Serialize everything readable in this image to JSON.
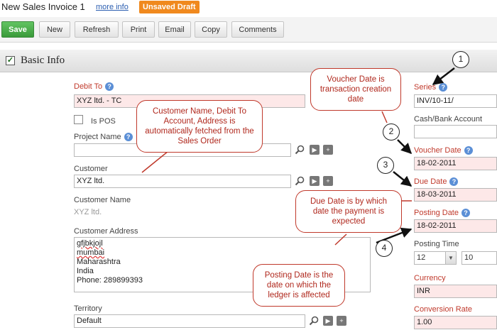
{
  "header": {
    "title": "New Sales Invoice 1",
    "more_info": "more info",
    "status": "Unsaved Draft"
  },
  "toolbar": {
    "save": "Save",
    "new": "New",
    "refresh": "Refresh",
    "print": "Print",
    "email": "Email",
    "copy": "Copy",
    "comments": "Comments"
  },
  "section": {
    "title": "Basic Info",
    "checked": "✓"
  },
  "left": {
    "debit_to": {
      "label": "Debit To",
      "value": "XYZ ltd. - TC"
    },
    "is_pos": {
      "label": "Is POS"
    },
    "project_name": {
      "label": "Project Name",
      "value": ""
    },
    "customer": {
      "label": "Customer",
      "value": "XYZ ltd."
    },
    "customer_name": {
      "label": "Customer Name",
      "value": "XYZ ltd."
    },
    "customer_address": {
      "label": "Customer Address",
      "lines": [
        "gfjbkjojl",
        "mumbai",
        "Maharashtra",
        "India",
        "Phone: 289899393"
      ]
    },
    "territory": {
      "label": "Territory",
      "value": "Default"
    }
  },
  "right": {
    "series": {
      "label": "Series",
      "value": "INV/10-11/"
    },
    "cash_bank": {
      "label": "Cash/Bank Account",
      "value": ""
    },
    "voucher_date": {
      "label": "Voucher Date",
      "value": "18-02-2011"
    },
    "due_date": {
      "label": "Due Date",
      "value": "18-03-2011"
    },
    "posting_date": {
      "label": "Posting Date",
      "value": "18-02-2011"
    },
    "posting_time": {
      "label": "Posting Time",
      "hour": "12",
      "minute": "10"
    },
    "currency": {
      "label": "Currency",
      "value": "INR"
    },
    "conversion_rate": {
      "label": "Conversion Rate",
      "value": "1.00"
    }
  },
  "callouts": {
    "voucher": "Voucher Date is transaction creation date",
    "customer": "Customer Name, Debit To Account, Address is automatically fetched from the Sales Order",
    "due": "Due Date is by which date the payment is expected",
    "posting": "Posting Date is the date on which the ledger is affected"
  },
  "markers": {
    "m1": "1",
    "m2": "2",
    "m3": "3",
    "m4": "4"
  },
  "icons": {
    "help": "?",
    "search": "magnifier-icon",
    "open": "play-icon",
    "add": "plus-icon"
  },
  "colors": {
    "required_label": "#c0392b",
    "required_bg": "#fde8e8",
    "save_button": "#3a9a3a",
    "draft_badge": "#f0891e",
    "callout": "#c0392b"
  }
}
